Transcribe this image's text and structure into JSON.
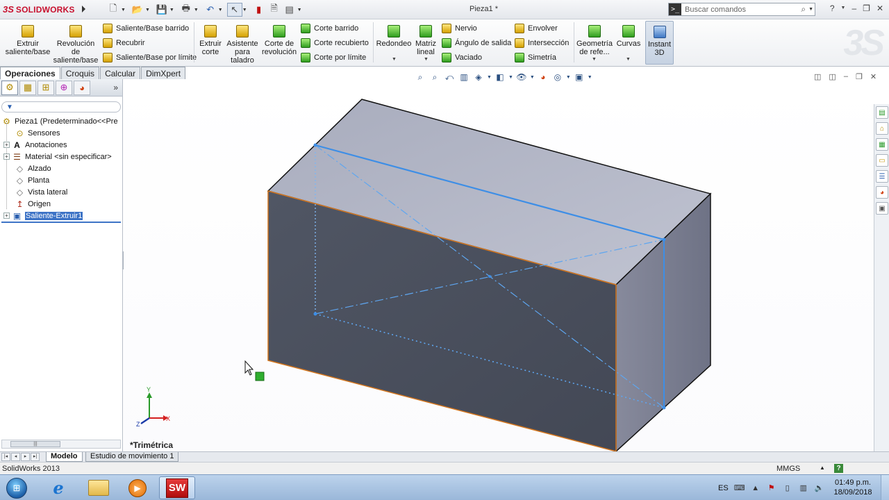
{
  "app": {
    "brand": "SOLIDWORKS",
    "document_title": "Pieza1 *",
    "search_placeholder": "Buscar comandos"
  },
  "ribbon": {
    "extruir_saliente": "Extruir saliente/base",
    "revolucion": "Revolución de saliente/base",
    "saliente_barrido": "Saliente/Base barrido",
    "recubrir": "Recubrir",
    "saliente_limite": "Saliente/Base por límite",
    "extruir_corte": "Extruir corte",
    "asistente_taladro": "Asistente para taladro",
    "corte_revolucion": "Corte de revolución",
    "corte_barrido": "Corte barrido",
    "corte_recubierto": "Corte recubierto",
    "corte_limite": "Corte por límite",
    "redondeo": "Redondeo",
    "matriz_lineal": "Matriz lineal",
    "nervio": "Nervio",
    "angulo_salida": "Ángulo de salida",
    "vaciado": "Vaciado",
    "envolver": "Envolver",
    "interseccion": "Intersección",
    "simetria": "Simetría",
    "geometria_ref": "Geometría de refe...",
    "curvas": "Curvas",
    "instant3d": "Instant 3D"
  },
  "cm_tabs": [
    "Operaciones",
    "Croquis",
    "Calcular",
    "DimXpert"
  ],
  "feature_tree": {
    "root": "Pieza1  (Predeterminado<<Pre",
    "items": [
      {
        "label": "Sensores",
        "icon": "sensor-icon",
        "expandable": false
      },
      {
        "label": "Anotaciones",
        "icon": "annotation-icon",
        "expandable": true
      },
      {
        "label": "Material <sin especificar>",
        "icon": "material-icon",
        "expandable": true
      },
      {
        "label": "Alzado",
        "icon": "plane-icon",
        "expandable": false
      },
      {
        "label": "Planta",
        "icon": "plane-icon",
        "expandable": false
      },
      {
        "label": "Vista lateral",
        "icon": "plane-icon",
        "expandable": false
      },
      {
        "label": "Origen",
        "icon": "origin-icon",
        "expandable": false
      },
      {
        "label": "Saliente-Extruir1",
        "icon": "extrude-icon",
        "expandable": true
      }
    ]
  },
  "viewport": {
    "view_name": "*Trimétrica",
    "triad_x": "X",
    "triad_y": "Y",
    "triad_z": "Z"
  },
  "bottom_tabs": [
    "Modelo",
    "Estudio de movimiento 1"
  ],
  "status": {
    "product": "SolidWorks 2013",
    "units": "MMGS"
  },
  "taskbar": {
    "language": "ES",
    "time": "01:49 p.m.",
    "date": "18/09/2018"
  },
  "colors": {
    "sketch_blue": "#3d8ee6",
    "edge_orange": "#d4761e",
    "front_face": "#4a4f5c",
    "top_face": "#b2b6c6",
    "side_face": "#7f8397"
  }
}
